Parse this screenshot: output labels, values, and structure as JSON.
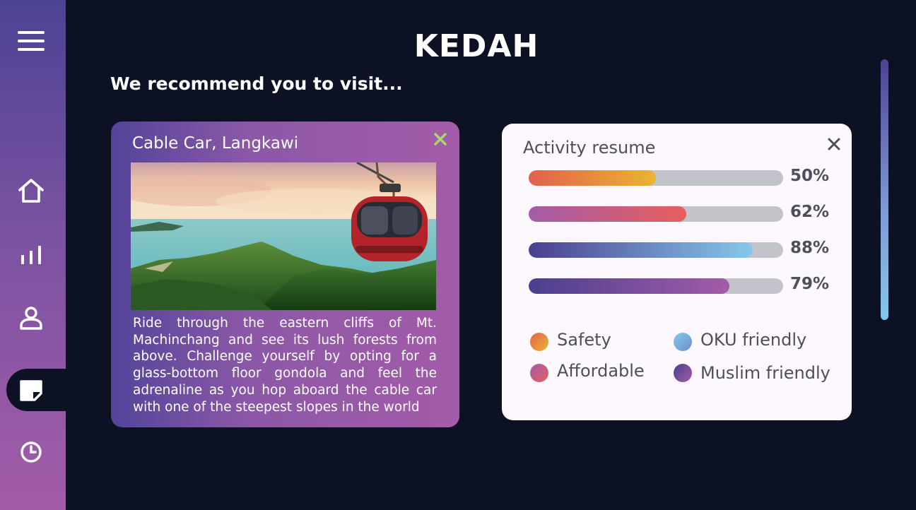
{
  "header": {
    "title": "KEDAH",
    "subtitle": "We recommend you to visit..."
  },
  "sidebar": {
    "items": [
      {
        "icon": "menu-icon"
      },
      {
        "icon": "home-icon"
      },
      {
        "icon": "chart-icon"
      },
      {
        "icon": "user-icon"
      },
      {
        "icon": "note-icon",
        "active": true
      },
      {
        "icon": "clock-icon"
      }
    ]
  },
  "place": {
    "title": "Cable Car, Langkawi",
    "description": "Ride through the eastern cliffs of Mt. Machinchang and see its lush forests from above. Challenge yourself by opting for a glass-bottom floor gondola and feel the adrenaline as you hop aboard the cable car with one of the steepest slopes in the world",
    "close_icon": "close-icon",
    "close_color": "#a9d86e"
  },
  "activity": {
    "title": "Activity resume",
    "bars": [
      {
        "label": "Safety",
        "value": 50,
        "percent_text": "50%",
        "gradient": [
          "#e2614e",
          "#eab52f"
        ]
      },
      {
        "label": "Affordable",
        "value": 62,
        "percent_text": "62%",
        "gradient": [
          "#a35ca8",
          "#e85e5c"
        ]
      },
      {
        "label": "OKU friendly",
        "value": 88,
        "percent_text": "88%",
        "gradient": [
          "#4a3f8f",
          "#86c8ea"
        ]
      },
      {
        "label": "Muslim friendly",
        "value": 79,
        "percent_text": "79%",
        "gradient": [
          "#4a3f8f",
          "#a35ca8"
        ]
      }
    ],
    "legend": [
      {
        "label": "Safety",
        "gradient": [
          "#e2614e",
          "#eab52f"
        ]
      },
      {
        "label": "OKU friendly",
        "gradient": [
          "#86c8ea",
          "#6a8fd0"
        ]
      },
      {
        "label": "Affordable",
        "gradient": [
          "#a35ca8",
          "#e85e5c"
        ]
      },
      {
        "label": "Muslim friendly",
        "gradient": [
          "#4a3f8f",
          "#a35ca8"
        ]
      }
    ]
  },
  "colors": {
    "background": "#0c1124",
    "sidebar_top": "#4d4393",
    "sidebar_bottom": "#a35ca8",
    "bar_track": "#c3c3cc",
    "text_dark": "#4d4f5c"
  }
}
